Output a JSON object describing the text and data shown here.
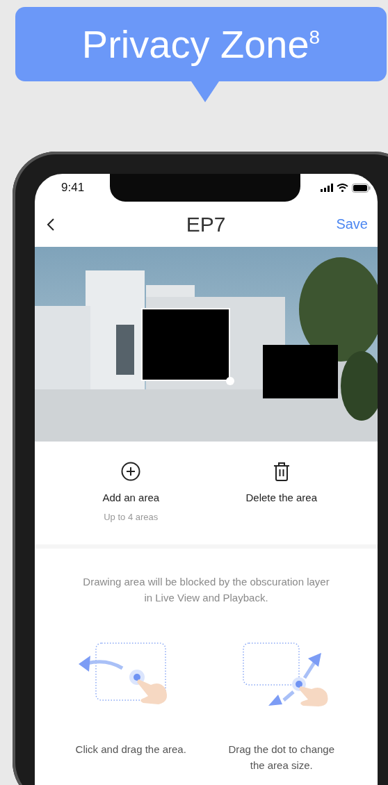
{
  "banner": {
    "title": "Privacy Zone$^{8}$"
  },
  "status_bar": {
    "time": "9:41"
  },
  "nav": {
    "title": "EP7",
    "action": "Save"
  },
  "camera_view": {
    "zones": [
      {
        "selected": true
      },
      {
        "selected": false
      }
    ]
  },
  "actions": [
    {
      "kind": "add",
      "label": "Add an area",
      "hint": "Up to 4 areas"
    },
    {
      "kind": "delete",
      "label": "Delete the area"
    }
  ],
  "notice": "Drawing area will be blocked by the obscuration layer in Live View and Playback.",
  "tips": [
    {
      "kind": "move",
      "caption": "Click and drag the area."
    },
    {
      "kind": "resize",
      "caption": "Drag the dot to change the area size."
    }
  ]
}
